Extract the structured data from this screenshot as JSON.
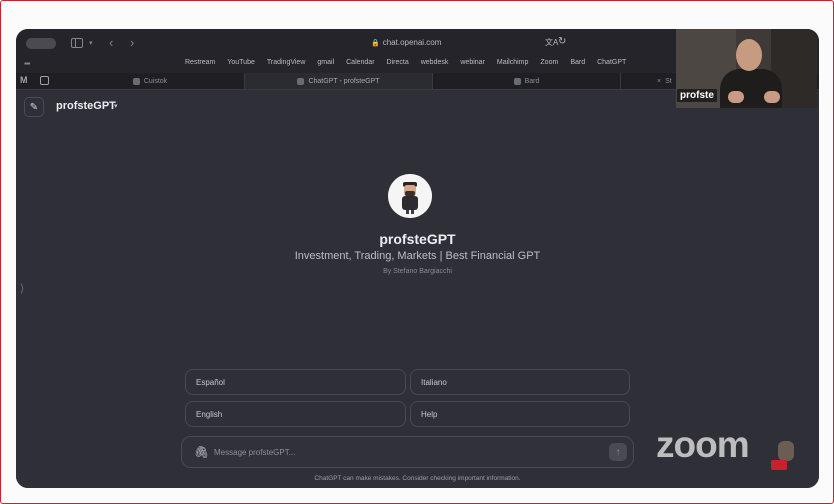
{
  "browser": {
    "url": "chat.openai.com",
    "bookmarks": [
      "Restream",
      "YouTube",
      "TradingView",
      "gmail",
      "Calendar",
      "Directa",
      "webdesk",
      "webinar",
      "Mailchimp",
      "Zoom",
      "Bard",
      "ChatGPT"
    ],
    "tabs": [
      {
        "label": "Cuistok"
      },
      {
        "label": "ChatGPT - profsteGPT"
      },
      {
        "label": "Bard"
      },
      {
        "label": "St"
      }
    ]
  },
  "chat": {
    "model_name": "profsteGPT",
    "gpt_title": "profsteGPT",
    "gpt_description": "Investment, Trading, Markets | Best Financial GPT",
    "gpt_author": "By Stefano Bargiacchi",
    "starters": [
      "Español",
      "Italiano",
      "English",
      "Help"
    ],
    "message_placeholder": "Message profsteGPT...",
    "footer_note": "ChatGPT can make mistakes. Consider checking important information."
  },
  "webcam": {
    "name": "profste"
  },
  "overlay": {
    "zoom_logo": "zoom"
  },
  "icons": {
    "new_chat": "edit-icon",
    "attach": "paperclip-icon",
    "send": "arrow-up-icon",
    "lock": "lock-icon",
    "reload": "reload-icon"
  },
  "colors": {
    "page_bg": "#2f2f38",
    "toolbar_bg": "#24242a",
    "frame_border": "#c8202c"
  }
}
